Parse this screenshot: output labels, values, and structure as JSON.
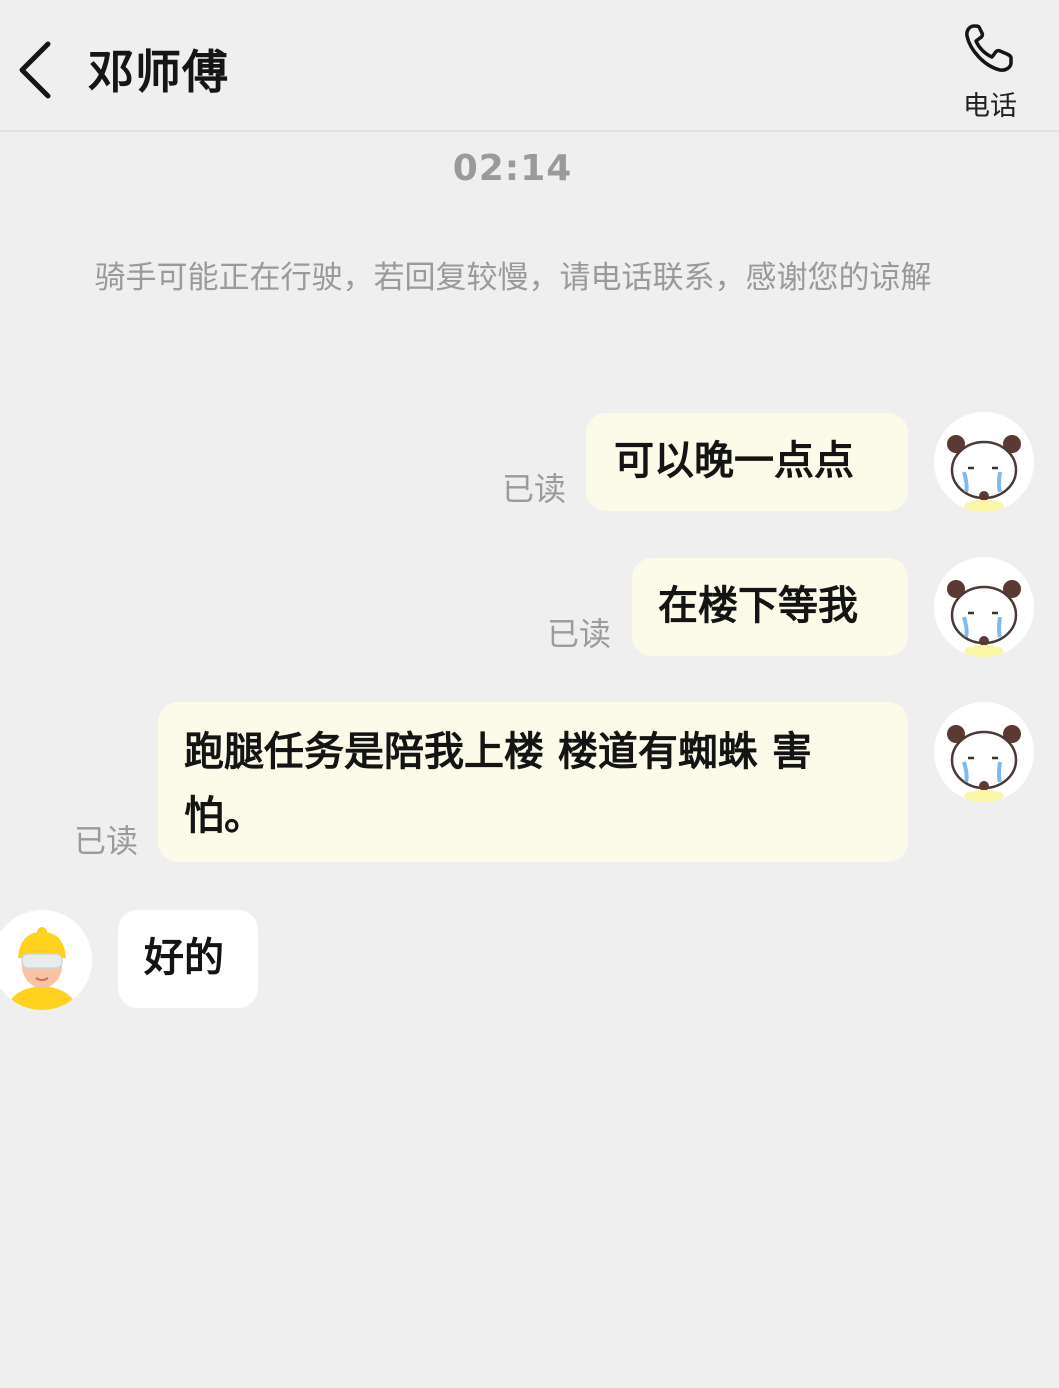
{
  "header": {
    "title": "邓师傅",
    "phone_label": "电话"
  },
  "chat": {
    "timestamp": "02:14",
    "notice": "骑手可能正在行驶，若回复较慢，请电话联系，感谢您的谅解",
    "messages": [
      {
        "sender": "me",
        "text": "可以晚一点点",
        "status": "已读"
      },
      {
        "sender": "me",
        "text": "在楼下等我",
        "status": "已读"
      },
      {
        "sender": "me",
        "text": "跑腿任务是陪我上楼 楼道有蜘蛛 害怕。",
        "status": "已读"
      },
      {
        "sender": "rider",
        "text": "好的"
      }
    ]
  },
  "colors": {
    "background": "#efefef",
    "my_bubble": "#fcfbe9",
    "their_bubble": "#ffffff",
    "muted_text": "#9a9a9a",
    "rider_helmet": "#ffd21f"
  },
  "icons": {
    "back": "chevron-left-icon",
    "phone": "phone-icon",
    "my_avatar": "panda-sticker-avatar",
    "rider_avatar": "rider-helmet-avatar"
  }
}
